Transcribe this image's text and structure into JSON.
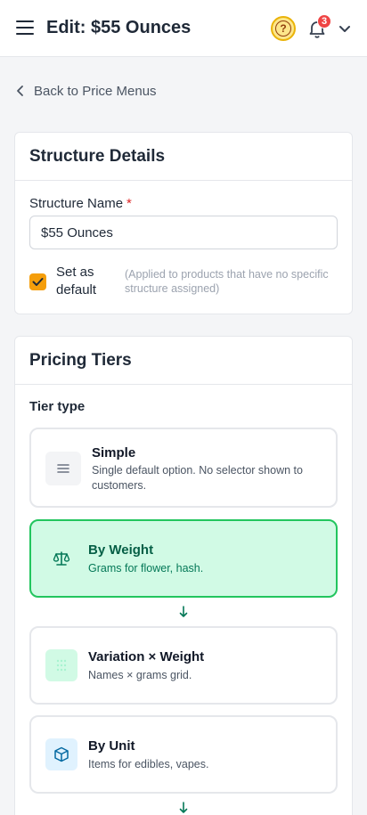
{
  "header": {
    "title": "Edit: $55 Ounces",
    "notification_count": "3",
    "help_glyph": "?"
  },
  "back_link": {
    "label": "Back to Price Menus"
  },
  "structure": {
    "heading": "Structure Details",
    "name_label": "Structure Name",
    "required_mark": "*",
    "name_value": "$55 Ounces",
    "default_checked": true,
    "default_label": "Set as default",
    "default_hint": "(Applied to products that have no specific structure assigned)"
  },
  "pricing": {
    "heading": "Pricing Tiers",
    "tier_type_label": "Tier type",
    "tiers": [
      {
        "title": "Simple",
        "desc": "Single default option. No selector shown to customers.",
        "icon": "lines-icon",
        "selected": false
      },
      {
        "title": "By Weight",
        "desc": "Grams for flower, hash.",
        "icon": "scale-icon",
        "selected": true
      },
      {
        "title": "Variation × Weight",
        "desc": "Names × grams grid.",
        "icon": "grid-dots-icon",
        "selected": false
      },
      {
        "title": "By Unit",
        "desc": "Items for edibles, vapes.",
        "icon": "box-icon",
        "selected": false
      }
    ]
  },
  "colors": {
    "accent": "#f59e0b",
    "selected_border": "#22c55e",
    "selected_bg": "#d1fae5",
    "badge": "#ef4444"
  }
}
